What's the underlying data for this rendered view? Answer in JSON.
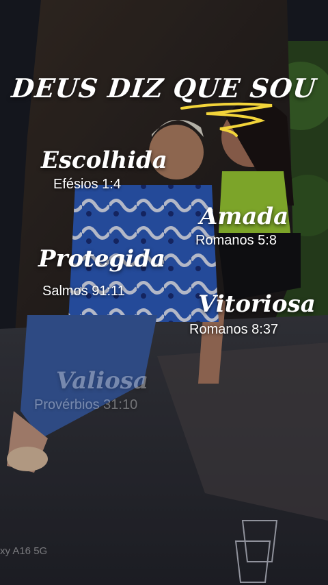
{
  "title": "DEUS DIZ QUE SOU",
  "items": [
    {
      "word": "Escolhida",
      "ref": "Efésios 1:4"
    },
    {
      "word": "Amada",
      "ref": "Romanos 5:8"
    },
    {
      "word": "Protegida",
      "ref": "Salmos 91:11"
    },
    {
      "word": "Vitoriosa",
      "ref": "Romanos 8:37"
    },
    {
      "word": "Valiosa",
      "ref": "Provérbios 31:10"
    }
  ],
  "watermark": "xy A16 5G",
  "colors": {
    "accent": "#f2d43a",
    "text": "#ffffff"
  }
}
